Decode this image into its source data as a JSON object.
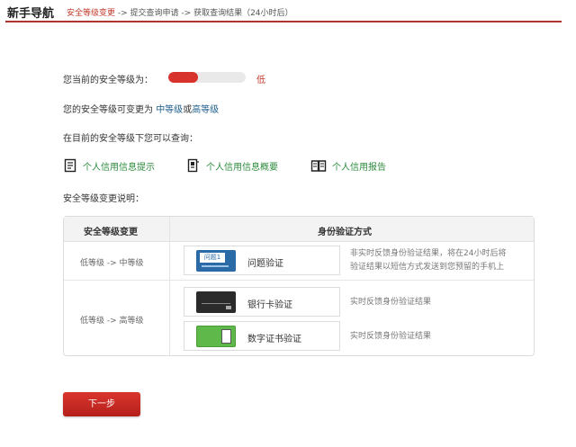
{
  "header": {
    "title": "新手导航",
    "step1": "安全等级变更",
    "arrow1": " -> ",
    "step2": "提交查询申请",
    "arrow2": " -> ",
    "step3": "获取查询结果（24小时后）"
  },
  "security": {
    "current_label": "您当前的安全等级为：",
    "level_value": "低",
    "level_fraction": 0.38,
    "change_prefix": "您的安全等级可变更为",
    "change_mid": "中等级",
    "change_or": "或",
    "change_high": "高等级",
    "query_label": "在目前的安全等级下您可以查询：",
    "change_desc_label": "安全等级变更说明："
  },
  "query_links": [
    {
      "label": "个人信用信息提示",
      "icon": "document-icon"
    },
    {
      "label": "个人信用信息概要",
      "icon": "document-summary-icon"
    },
    {
      "label": "个人信用报告",
      "icon": "book-icon"
    }
  ],
  "table": {
    "col1": "安全等级变更",
    "col2": "身份验证方式",
    "row1_change": "低等级 -> 中等级",
    "row2_change": "低等级 -> 高等级",
    "methods": [
      {
        "label": "问题验证",
        "icon_text": "问题1",
        "desc_line1": "非实时反馈身份验证结果，将在24小时后将",
        "desc_line2": "验证结果以短信方式发送到您预留的手机上"
      },
      {
        "label": "银行卡验证",
        "desc_line1": "实时反馈身份验证结果"
      },
      {
        "label": "数字证书验证",
        "desc_line1": "实时反馈身份验证结果"
      }
    ]
  },
  "next_button": "下一步",
  "colors": {
    "accent_red": "#c0392b",
    "link_green": "#2e8b3e"
  }
}
